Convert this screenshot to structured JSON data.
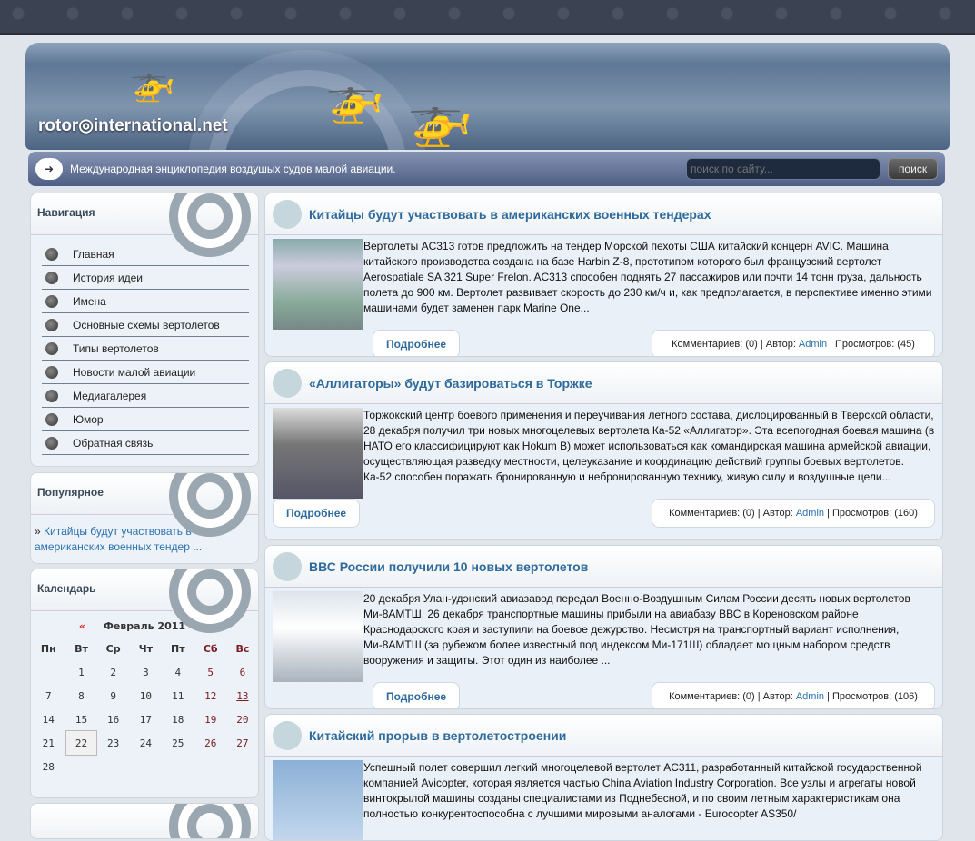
{
  "header": {
    "logo": "rotor◎international.net",
    "slogan": "Международная энциклопедия воздушых судов малой авиации.",
    "search_placeholder": "поиск по сайту...",
    "search_button": "поиск"
  },
  "sidebar": {
    "nav_title": "Навигация",
    "nav_items": [
      "Главная",
      "История идеи",
      "Имена",
      "Основные схемы вертолетов",
      "Типы вертолетов",
      "Новости малой авиации",
      "Медиагалерея",
      "Юмор",
      "Обратная связь"
    ],
    "popular_title": "Популярное",
    "popular_link": "Китайцы будут участвовать в американских военных тендер ...",
    "calendar_title": "Календарь",
    "calendar": {
      "prev": "«",
      "month": "Февраль 2011",
      "next": "»",
      "days": [
        "Пн",
        "Вт",
        "Ср",
        "Чт",
        "Пт",
        "Сб",
        "Вс"
      ],
      "weeks": [
        [
          "",
          "1",
          "2",
          "3",
          "4",
          "5",
          "6"
        ],
        [
          "7",
          "8",
          "9",
          "10",
          "11",
          "12",
          "13"
        ],
        [
          "14",
          "15",
          "16",
          "17",
          "18",
          "19",
          "20"
        ],
        [
          "21",
          "22",
          "23",
          "24",
          "25",
          "26",
          "27"
        ],
        [
          "28",
          "",
          "",
          "",
          "",
          "",
          ""
        ]
      ],
      "today": "22"
    }
  },
  "posts": [
    {
      "title": "Китайцы будут участвовать в американских военных тендерах",
      "text": "Вертолеты AC313 готов предложить на тендер Морской пехоты США китайский концерн AVIC. Машина китайского производства создана на базе Harbin Z-8, прототипом которого был французский вертолет Aerospatiale SA 321 Super Frelon. AC313 способен поднять 27 пассажиров или почти 14 тонн груза, дальность полета до 900 км. Вертолет развивает скорость до 230 км/ч и, как предполагается, в перспективе именно этими машинами будет заменен парк Marine One...",
      "more": "Подробнее",
      "comments": "Комментариев: (0) | Автор:",
      "author": "Admin",
      "views": "| Просмотров: (45)"
    },
    {
      "title": "«Аллигаторы» будут базироваться в Торжке",
      "text": "Торжокский центр боевого применения и переучивания летного состава, дислоцированный в Тверской области, 28 декабря получил три новых многоцелевых вертолета Ка-52 «Аллигатор». Эта всепогодная боевая машина (в НАТО его классифицируют как Hokum B) может использоваться как командирская машина армейской авиации, осуществляющая разведку местности, целеуказание и координацию действий группы боевых вертолетов. Ка-52 способен поражать бронированную и небронированную технику, живую силу и воздушные цели...",
      "more": "Подробнее",
      "comments": "Комментариев: (0) | Автор:",
      "author": "Admin",
      "views": "| Просмотров: (160)"
    },
    {
      "title": "ВВС России получили 10 новых вертолетов",
      "text": "20 декабря Улан-удэнский авиазавод передал Военно-Воздушным Силам России десять новых вертолетов Ми-8АМТШ. 26 декабря транспортные машины прибыли на авиабазу ВВС в Кореновском районе Краснодарского края и заступили на боевое дежурство. Несмотря на транспортный вариант исполнения, Ми-8АМТШ (за рубежом более известный под индексом Ми-171Ш) обладает мощным набором средств вооружения и защиты. Этот один из наиболее ...",
      "more": "Подробнее",
      "comments": "Комментариев: (0) | Автор:",
      "author": "Admin",
      "views": "| Просмотров: (106)"
    },
    {
      "title": "Китайский прорыв в вертолетостроении",
      "text": "Успешный полет совершил легкий многоцелевой вертолет AC311, разработанный китайской государственной компанией Avicopter, которая является частью China Aviation Industry Corporation. Все узлы и агрегаты новой винтокрылой машины созданы специалистами из Поднебесной, и по своим летным характеристикам она полностью конкурентоспособна с лучшими мировыми аналогами - Eurocopter AS350/"
    }
  ]
}
